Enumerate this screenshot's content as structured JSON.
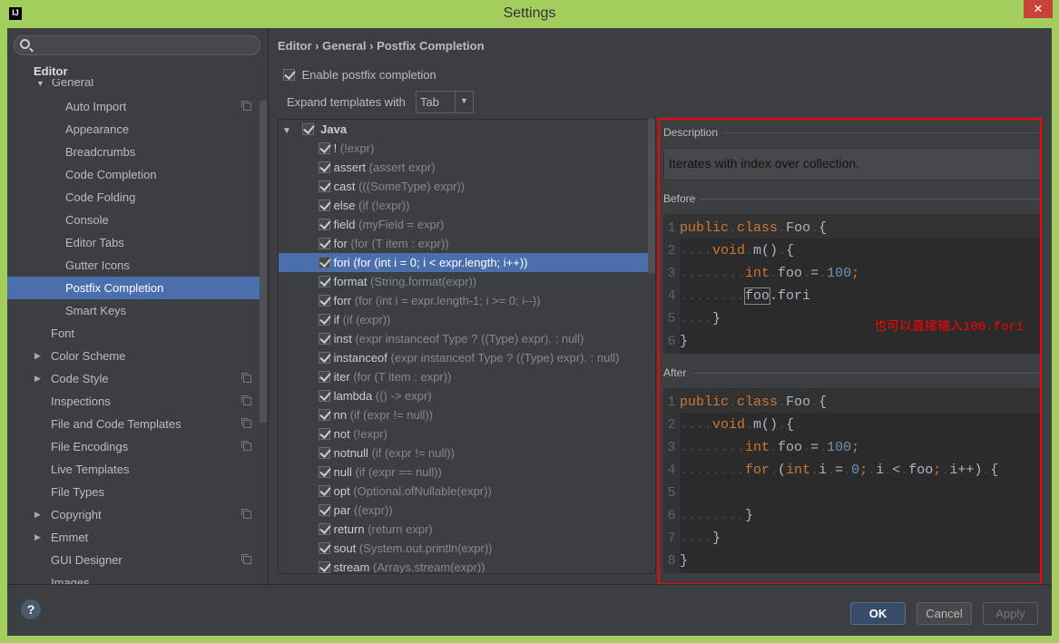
{
  "window": {
    "title": "Settings",
    "logo": "IJ",
    "close": "✕"
  },
  "sidebar": {
    "section": "Editor",
    "group": "General",
    "items": [
      {
        "label": "Auto Import",
        "indent": 2,
        "copy": true
      },
      {
        "label": "Appearance",
        "indent": 2
      },
      {
        "label": "Breadcrumbs",
        "indent": 2
      },
      {
        "label": "Code Completion",
        "indent": 2
      },
      {
        "label": "Code Folding",
        "indent": 2
      },
      {
        "label": "Console",
        "indent": 2
      },
      {
        "label": "Editor Tabs",
        "indent": 2
      },
      {
        "label": "Gutter Icons",
        "indent": 2
      },
      {
        "label": "Postfix Completion",
        "indent": 2,
        "selected": true
      },
      {
        "label": "Smart Keys",
        "indent": 2
      },
      {
        "label": "Font",
        "indent": 1
      },
      {
        "label": "Color Scheme",
        "indent": 1,
        "expandable": true
      },
      {
        "label": "Code Style",
        "indent": 1,
        "expandable": true,
        "copy": true
      },
      {
        "label": "Inspections",
        "indent": 1,
        "copy": true
      },
      {
        "label": "File and Code Templates",
        "indent": 1,
        "copy": true
      },
      {
        "label": "File Encodings",
        "indent": 1,
        "copy": true
      },
      {
        "label": "Live Templates",
        "indent": 1
      },
      {
        "label": "File Types",
        "indent": 1
      },
      {
        "label": "Copyright",
        "indent": 1,
        "expandable": true,
        "copy": true
      },
      {
        "label": "Emmet",
        "indent": 1,
        "expandable": true
      },
      {
        "label": "GUI Designer",
        "indent": 1,
        "copy": true
      },
      {
        "label": "Images",
        "indent": 1
      }
    ]
  },
  "main": {
    "breadcrumb": "Editor › General › Postfix Completion",
    "enable_label": "Enable postfix completion",
    "enable_checked": true,
    "expand_label": "Expand templates with",
    "expand_value": "Tab",
    "tree_root": "Java",
    "templates": [
      {
        "key": "!",
        "desc": "(!expr)"
      },
      {
        "key": "assert",
        "desc": "(assert expr)"
      },
      {
        "key": "cast",
        "desc": "(((SomeType) expr))"
      },
      {
        "key": "else",
        "desc": "(if (!expr))"
      },
      {
        "key": "field",
        "desc": "(myField = expr)"
      },
      {
        "key": "for",
        "desc": "(for (T item : expr))"
      },
      {
        "key": "fori",
        "desc": "(for (int i = 0; i < expr.length; i++))",
        "selected": true
      },
      {
        "key": "format",
        "desc": "(String.format(expr))"
      },
      {
        "key": "forr",
        "desc": "(for (int i = expr.length-1; i >= 0; i--))"
      },
      {
        "key": "if",
        "desc": "(if (expr))"
      },
      {
        "key": "inst",
        "desc": "(expr instanceof Type ? ((Type) expr). : null)"
      },
      {
        "key": "instanceof",
        "desc": "(expr instanceof Type ? ((Type) expr). : null)"
      },
      {
        "key": "iter",
        "desc": "(for (T item : expr))"
      },
      {
        "key": "lambda",
        "desc": "(() -> expr)"
      },
      {
        "key": "nn",
        "desc": "(if (expr != null))"
      },
      {
        "key": "not",
        "desc": "(!expr)"
      },
      {
        "key": "notnull",
        "desc": "(if (expr != null))"
      },
      {
        "key": "null",
        "desc": "(if (expr == null))"
      },
      {
        "key": "opt",
        "desc": "(Optional.ofNullable(expr))"
      },
      {
        "key": "par",
        "desc": "((expr))"
      },
      {
        "key": "return",
        "desc": "(return expr)"
      },
      {
        "key": "sout",
        "desc": "(System.out.println(expr))"
      },
      {
        "key": "stream",
        "desc": "(Arrays.stream(expr))"
      }
    ]
  },
  "details": {
    "description_label": "Description",
    "description": "Iterates with index over collection.",
    "before_label": "Before",
    "after_label": "After",
    "before_code": [
      [
        [
          "kw",
          "public"
        ],
        [
          "ws",
          "."
        ],
        [
          "kw",
          "class"
        ],
        [
          "ws",
          "."
        ],
        [
          "id",
          "Foo"
        ],
        [
          "ws",
          "."
        ],
        [
          "id",
          "{"
        ]
      ],
      [
        [
          "ws",
          "...."
        ],
        [
          "kw",
          "void"
        ],
        [
          "ws",
          "."
        ],
        [
          "id",
          "m()"
        ],
        [
          "ws",
          "."
        ],
        [
          "id",
          "{"
        ]
      ],
      [
        [
          "ws",
          "........"
        ],
        [
          "kw",
          "int"
        ],
        [
          "ws",
          "."
        ],
        [
          "id",
          "foo"
        ],
        [
          "ws",
          "."
        ],
        [
          "id",
          "="
        ],
        [
          "ws",
          "."
        ],
        [
          "num",
          "100"
        ],
        [
          "kw",
          ";"
        ]
      ],
      [
        [
          "ws",
          "........"
        ],
        [
          "box",
          "foo"
        ],
        [
          "id",
          ".fori"
        ]
      ],
      [
        [
          "ws",
          "...."
        ],
        [
          "id",
          "}"
        ]
      ],
      [
        [
          "id",
          "}"
        ]
      ]
    ],
    "after_code": [
      [
        [
          "kw",
          "public"
        ],
        [
          "ws",
          "."
        ],
        [
          "kw",
          "class"
        ],
        [
          "ws",
          "."
        ],
        [
          "id",
          "Foo"
        ],
        [
          "ws",
          "."
        ],
        [
          "id",
          "{"
        ]
      ],
      [
        [
          "ws",
          "...."
        ],
        [
          "kw",
          "void"
        ],
        [
          "ws",
          "."
        ],
        [
          "id",
          "m()"
        ],
        [
          "ws",
          "."
        ],
        [
          "id",
          "{"
        ]
      ],
      [
        [
          "ws",
          "........"
        ],
        [
          "kw",
          "int"
        ],
        [
          "ws",
          "."
        ],
        [
          "id",
          "foo"
        ],
        [
          "ws",
          "."
        ],
        [
          "id",
          "="
        ],
        [
          "ws",
          "."
        ],
        [
          "num",
          "100"
        ],
        [
          "kw",
          ";"
        ]
      ],
      [
        [
          "ws",
          "........"
        ],
        [
          "kw",
          "for"
        ],
        [
          "ws",
          "."
        ],
        [
          "id",
          "("
        ],
        [
          "kw",
          "int"
        ],
        [
          "ws",
          "."
        ],
        [
          "id",
          "i"
        ],
        [
          "ws",
          "."
        ],
        [
          "id",
          "="
        ],
        [
          "ws",
          "."
        ],
        [
          "num",
          "0"
        ],
        [
          "kw",
          ";"
        ],
        [
          "ws",
          "."
        ],
        [
          "id",
          "i"
        ],
        [
          "ws",
          "."
        ],
        [
          "id",
          "<"
        ],
        [
          "ws",
          "."
        ],
        [
          "id",
          "foo"
        ],
        [
          "kw",
          ";"
        ],
        [
          "ws",
          "."
        ],
        [
          "id",
          "i++)"
        ],
        [
          "ws",
          "."
        ],
        [
          "id",
          "{"
        ]
      ],
      [],
      [
        [
          "ws",
          "........"
        ],
        [
          "id",
          "}"
        ]
      ],
      [
        [
          "ws",
          "...."
        ],
        [
          "id",
          "}"
        ]
      ],
      [
        [
          "id",
          "}"
        ]
      ]
    ],
    "annotation": "也可以直接输入100.fori"
  },
  "buttons": {
    "ok": "OK",
    "cancel": "Cancel",
    "apply": "Apply",
    "help": "?"
  },
  "colors": {
    "accent": "#4b6eaf",
    "highlight_border": "#ff0000",
    "window_frame": "#a3cd5d"
  }
}
